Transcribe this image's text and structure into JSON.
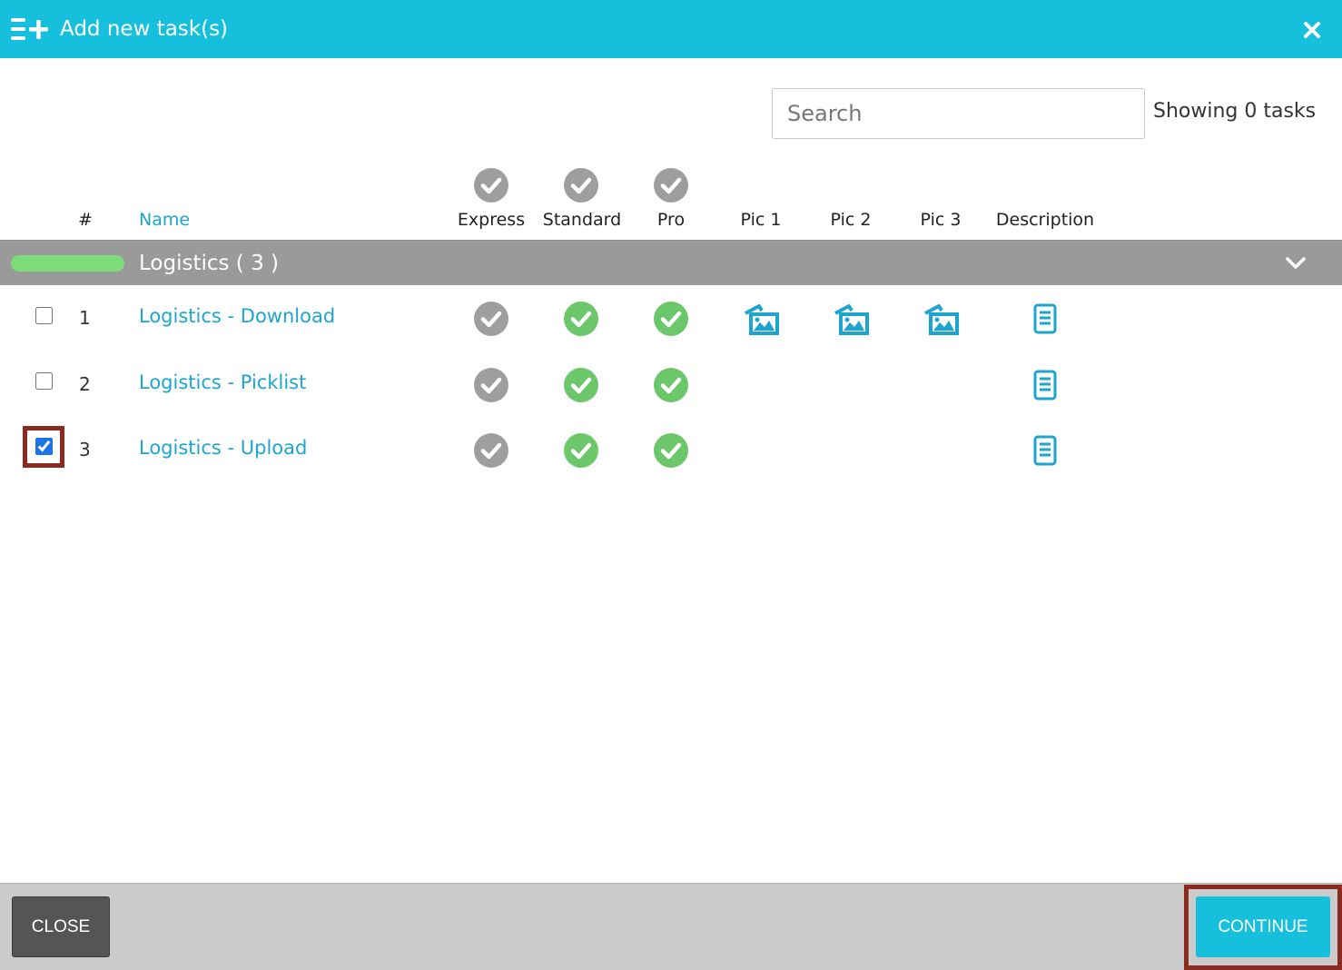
{
  "dialog": {
    "title": "Add new task(s)",
    "icon": "add-list-icon",
    "close_icon": "close-icon"
  },
  "search": {
    "placeholder": "Search",
    "value": ""
  },
  "status": {
    "showing_text": "Showing 0 tasks"
  },
  "table": {
    "columns": {
      "number": "#",
      "name": "Name",
      "express": "Express",
      "standard": "Standard",
      "pro": "Pro",
      "pic1": "Pic 1",
      "pic2": "Pic 2",
      "pic3": "Pic 3",
      "description": "Description"
    },
    "group": {
      "label": "Logistics ( 3 )",
      "pill_color": "#7ddb79",
      "toggle_icon": "chevron-down-icon"
    },
    "rows": [
      {
        "checked": false,
        "number": "1",
        "name": "Logistics - Download",
        "express": false,
        "standard": true,
        "pro": true,
        "has_pictures": true,
        "has_description": true
      },
      {
        "checked": false,
        "number": "2",
        "name": "Logistics - Picklist",
        "express": false,
        "standard": true,
        "pro": true,
        "has_pictures": false,
        "has_description": true
      },
      {
        "checked": true,
        "number": "3",
        "name": "Logistics - Upload",
        "express": false,
        "standard": true,
        "pro": true,
        "has_pictures": false,
        "has_description": true
      }
    ]
  },
  "footer": {
    "close_label": "CLOSE",
    "continue_label": "CONTINUE"
  },
  "colors": {
    "accent": "#16bfdb",
    "link": "#1da5cf",
    "check_active": "#6cc76a",
    "check_inactive": "#9e9e9e",
    "group_bar": "#9a9a9a",
    "highlight": "#8b2a1e"
  }
}
